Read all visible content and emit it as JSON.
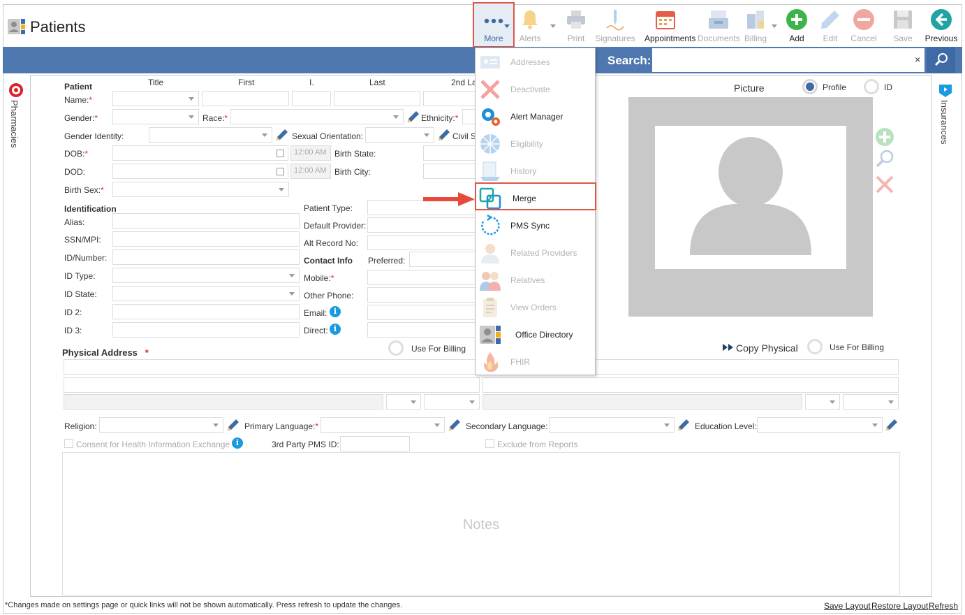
{
  "app": {
    "title": "Patients"
  },
  "toolbar": {
    "more": "More",
    "alerts": "Alerts",
    "print": "Print",
    "signatures": "Signatures",
    "appointments": "Appointments",
    "documents": "Documents",
    "billing": "Billing",
    "add": "Add",
    "edit": "Edit",
    "cancel": "Cancel",
    "save": "Save",
    "previous": "Previous"
  },
  "search": {
    "label": "Search:",
    "clear": "×",
    "value": ""
  },
  "side": {
    "left": "Pharmacies",
    "right": "Insurances"
  },
  "form": {
    "patient_header": "Patient",
    "col_title": "Title",
    "col_first": "First",
    "col_initial": "I.",
    "col_last": "Last",
    "col_2nd": "2nd La",
    "name": "Name:",
    "gender": "Gender:",
    "race": "Race:",
    "ethnicity": "Ethnicity:",
    "gender_identity": "Gender Identity:",
    "sexual_orientation": "Sexual Orientation:",
    "civil": "Civil S",
    "dob": "DOB:",
    "dod": "DOD:",
    "time_placeholder": "12:00 AM",
    "birth_state": "Birth State:",
    "birth_city": "Birth City:",
    "birth_sex": "Birth Sex:",
    "identification": "Identification",
    "alias": "Alias:",
    "ssn": "SSN/MPI:",
    "id_number": "ID/Number:",
    "id_type": "ID Type:",
    "id_state": "ID State:",
    "id2": "ID 2:",
    "id3": "ID 3:",
    "patient_type": "Patient Type:",
    "default_provider": "Default Provider:",
    "alt_record": "Alt Record No:",
    "contact_info": "Contact Info",
    "preferred": "Preferred:",
    "mobile": "Mobile:",
    "other_phone": "Other Phone:",
    "email": "Email:",
    "direct": "Direct:",
    "physical_address": "Physical Address",
    "use_for_billing": "Use For Billing",
    "copy_physical": "Copy Physical",
    "use_for_billing_2": "Use For Billing",
    "religion": "Religion:",
    "primary_language": "Primary Language:",
    "secondary_language": "Secondary Language:",
    "education_level": "Education Level:",
    "consent": "Consent for Health Information Exchange",
    "third_party": "3rd Party PMS ID:",
    "exclude": "Exclude from Reports",
    "required_mark": "*"
  },
  "picture": {
    "title": "Picture",
    "profile": "Profile",
    "id": "ID",
    "selected": "Profile"
  },
  "notes": {
    "placeholder": "Notes"
  },
  "footer": {
    "note": "*Changes made on settings page or quick links will not be shown automatically. Press refresh to update the changes.",
    "save_layout": "Save Layout",
    "restore_layout": "Restore Layout",
    "refresh": "Refresh"
  },
  "menu": {
    "items": [
      {
        "label": "Addresses",
        "enabled": false,
        "icon": "address-card-icon"
      },
      {
        "label": "Deactivate",
        "enabled": false,
        "icon": "red-x-icon"
      },
      {
        "label": "Alert Manager",
        "enabled": true,
        "icon": "gears-icon"
      },
      {
        "label": "Eligibility",
        "enabled": false,
        "icon": "eligibility-wheel-icon"
      },
      {
        "label": "History",
        "enabled": false,
        "icon": "history-icon"
      },
      {
        "label": "Merge",
        "enabled": true,
        "icon": "merge-icon",
        "highlighted": true
      },
      {
        "label": "PMS Sync",
        "enabled": true,
        "icon": "sync-icon"
      },
      {
        "label": "Related Providers",
        "enabled": false,
        "icon": "providers-icon"
      },
      {
        "label": "Relatives",
        "enabled": false,
        "icon": "relatives-icon"
      },
      {
        "label": "View Orders",
        "enabled": false,
        "icon": "orders-icon"
      },
      {
        "label": "Office Directory",
        "enabled": true,
        "icon": "office-directory-icon"
      },
      {
        "label": "FHIR",
        "enabled": false,
        "icon": "fhir-flame-icon"
      }
    ]
  },
  "colors": {
    "accent_bar": "#4f78b1",
    "highlight": "#e05545",
    "add_green": "#3bb54a",
    "previous_teal": "#1fa3a3"
  }
}
